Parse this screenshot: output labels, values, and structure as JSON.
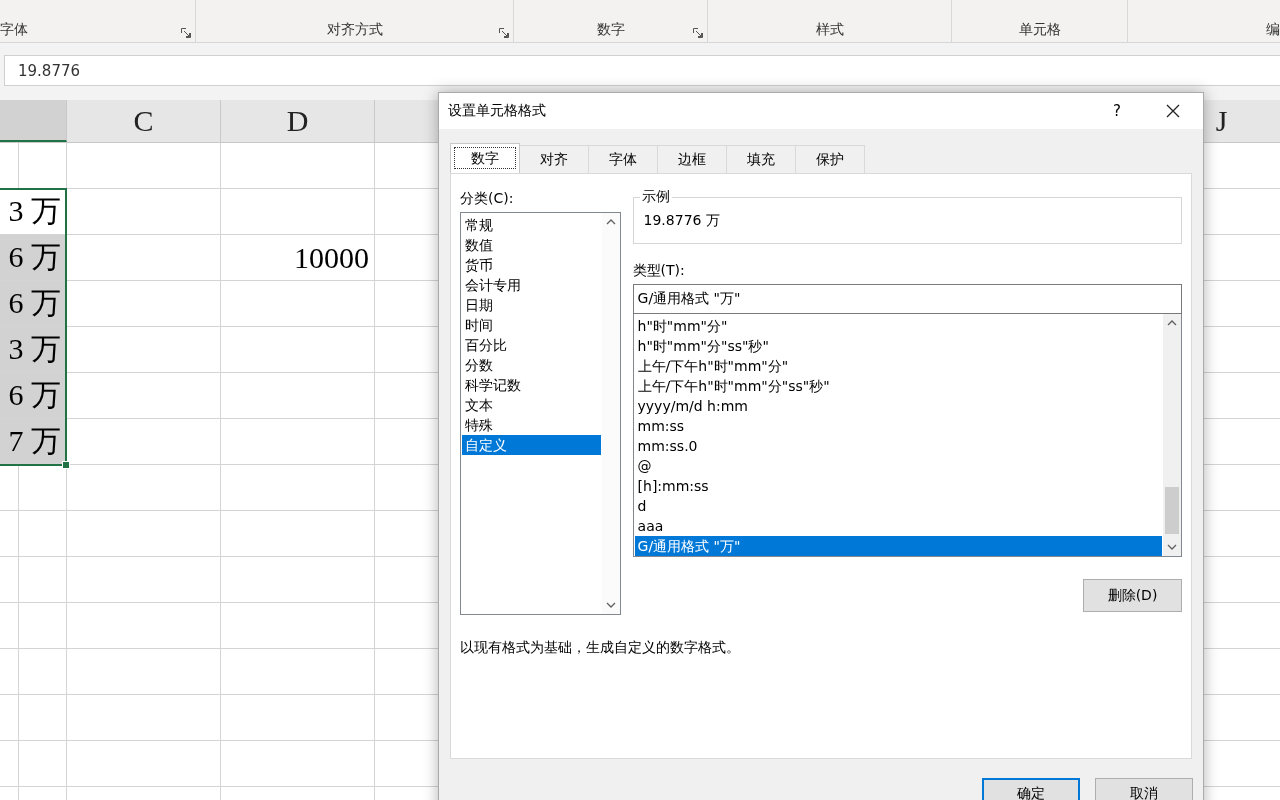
{
  "ribbon": {
    "groups": [
      {
        "label": "字体",
        "launcher": true
      },
      {
        "label": "对齐方式",
        "launcher": true
      },
      {
        "label": "数字",
        "launcher": true
      },
      {
        "label": "样式",
        "launcher": false
      },
      {
        "label": "单元格",
        "launcher": false
      },
      {
        "label": "编",
        "launcher": false
      }
    ]
  },
  "formula_bar": {
    "value": "19.8776"
  },
  "sheet": {
    "columns": [
      {
        "selected": true
      },
      {
        "label": "C",
        "selected": false
      },
      {
        "label": "D",
        "selected": false
      },
      {
        "label": "J",
        "selected": false
      }
    ],
    "rows": [
      {
        "selected": false
      },
      {
        "selected": true,
        "active": true,
        "b": "3 万"
      },
      {
        "selected": true,
        "active": false,
        "b": "6 万",
        "d": "10000"
      },
      {
        "selected": true,
        "active": false,
        "b": "6 万"
      },
      {
        "selected": true,
        "active": false,
        "b": "3 万"
      },
      {
        "selected": true,
        "active": false,
        "b": "6 万"
      },
      {
        "selected": true,
        "active": false,
        "b": "7 万"
      },
      {
        "selected": false
      },
      {
        "selected": false
      },
      {
        "selected": false
      },
      {
        "selected": false
      },
      {
        "selected": false
      },
      {
        "selected": false
      },
      {
        "selected": false
      },
      {
        "selected": false
      }
    ]
  },
  "dialog": {
    "title": "设置单元格格式",
    "help": "?",
    "tabs": [
      {
        "label": "数字",
        "selected": true
      },
      {
        "label": "对齐",
        "selected": false
      },
      {
        "label": "字体",
        "selected": false
      },
      {
        "label": "边框",
        "selected": false
      },
      {
        "label": "填充",
        "selected": false
      },
      {
        "label": "保护",
        "selected": false
      }
    ],
    "category_label": "分类(C):",
    "categories": [
      {
        "label": "常规",
        "selected": false
      },
      {
        "label": "数值",
        "selected": false
      },
      {
        "label": "货币",
        "selected": false
      },
      {
        "label": "会计专用",
        "selected": false
      },
      {
        "label": "日期",
        "selected": false
      },
      {
        "label": "时间",
        "selected": false
      },
      {
        "label": "百分比",
        "selected": false
      },
      {
        "label": "分数",
        "selected": false
      },
      {
        "label": "科学记数",
        "selected": false
      },
      {
        "label": "文本",
        "selected": false
      },
      {
        "label": "特殊",
        "selected": false
      },
      {
        "label": "自定义",
        "selected": true
      }
    ],
    "sample_label": "示例",
    "sample_value": "19.8776 万",
    "type_label": "类型(T):",
    "type_value": "G/通用格式 \"万\"",
    "formats": [
      {
        "label": "h\"时\"mm\"分\"",
        "selected": false
      },
      {
        "label": "h\"时\"mm\"分\"ss\"秒\"",
        "selected": false
      },
      {
        "label": "上午/下午h\"时\"mm\"分\"",
        "selected": false
      },
      {
        "label": "上午/下午h\"时\"mm\"分\"ss\"秒\"",
        "selected": false
      },
      {
        "label": "yyyy/m/d h:mm",
        "selected": false
      },
      {
        "label": "mm:ss",
        "selected": false
      },
      {
        "label": "mm:ss.0",
        "selected": false
      },
      {
        "label": "@",
        "selected": false
      },
      {
        "label": "[h]:mm:ss",
        "selected": false
      },
      {
        "label": "d",
        "selected": false
      },
      {
        "label": "aaa",
        "selected": false
      },
      {
        "label": "G/通用格式 \"万\"",
        "selected": true
      }
    ],
    "delete_button": "删除(D)",
    "description": "以现有格式为基础，生成自定义的数字格式。",
    "buttons": [
      {
        "label": "确定",
        "default": true
      },
      {
        "label": "取消",
        "default": false
      }
    ]
  }
}
